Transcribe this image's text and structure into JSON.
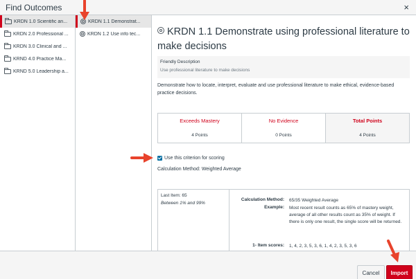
{
  "window": {
    "title": "Find Outcomes",
    "close_glyph": "×"
  },
  "groups": [
    {
      "label": "KRDN 1.0 Scientific an...",
      "icon": "folder-icon",
      "selected": true
    },
    {
      "label": "KRDN 2.0 Professional ...",
      "icon": "folder-icon",
      "selected": false
    },
    {
      "label": "KRDN 3.0 Clinical and ...",
      "icon": "folder-icon",
      "selected": false
    },
    {
      "label": "KRND 4.0 Practice Ma...",
      "icon": "folder-icon",
      "selected": false
    },
    {
      "label": "KRND 5.0 Leadership a...",
      "icon": "folder-icon",
      "selected": false
    }
  ],
  "outcomes": [
    {
      "label": "KRDN 1.1 Demonstrat...",
      "icon": "target-icon",
      "selected": true
    },
    {
      "label": "KRDN 1.2 Use info tec...",
      "icon": "target-icon",
      "selected": false
    }
  ],
  "detail": {
    "title": "KRDN 1.1 Demonstrate using professional literature to make decisions",
    "friendly_heading": "Friendly Description",
    "friendly_body": "Use professional literature to make decisions",
    "description": "Demonstrate how to locate, interpret, evaluate and use professional literature to make ethical, evidence-based practice decisions.",
    "rubric": [
      {
        "label": "Exceeds Mastery",
        "points": "4 Points"
      },
      {
        "label": "No Evidence",
        "points": "0 Points"
      },
      {
        "label": "Total Points",
        "points": "4 Points"
      }
    ],
    "use_for_scoring_label": "Use this criterion for scoring",
    "use_for_scoring_checked": true,
    "calculation_method_summary": "Calculation Method: Weighted Average",
    "calc_box": {
      "last_item": "Last Item: 65",
      "between": "Between 1% and 99%",
      "method_label": "Calculation Method:",
      "method_value": "65/35 Weighted Average",
      "example_label": "Example:",
      "example_value": "Most recent result counts as 65% of mastery weight, average of all other results count as 35% of weight. If there is only one result, the single score will be returned.",
      "item_scores_label": "1- Item scores:",
      "item_scores_value": "1, 4, 2, 3, 5, 3, 6, 1, 4, 2, 3, 5, 3, 6"
    }
  },
  "footer": {
    "cancel_label": "Cancel",
    "import_label": "Import"
  },
  "colors": {
    "accent": "#d0021b",
    "checkbox": "#0770a3",
    "annotation_arrow": "#e8432c"
  }
}
